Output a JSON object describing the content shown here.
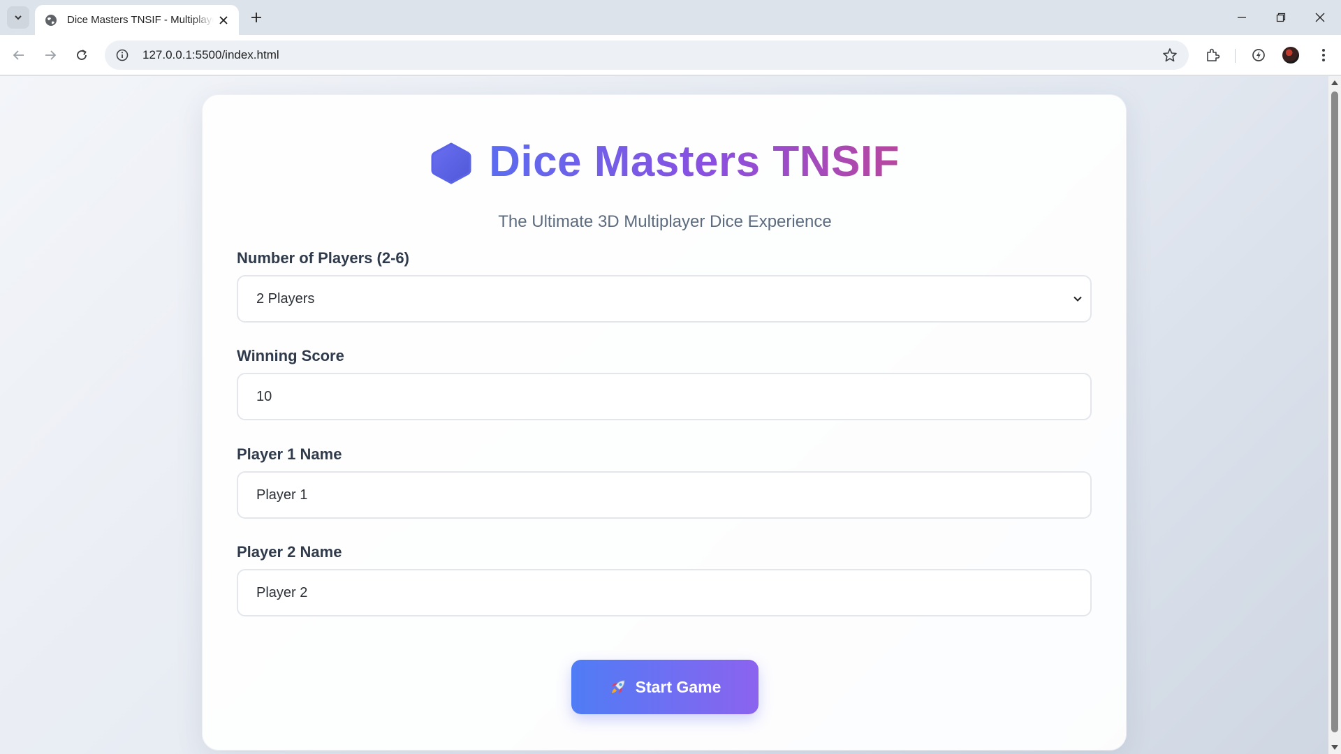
{
  "browser": {
    "tab_title": "Dice Masters TNSIF - Multiplayer",
    "url": "127.0.0.1:5500/index.html"
  },
  "header": {
    "title": "Dice Masters TNSIF",
    "subtitle": "The Ultimate 3D Multiplayer Dice Experience"
  },
  "form": {
    "players_label": "Number of Players (2-6)",
    "players_value": "2 Players",
    "score_label": "Winning Score",
    "score_value": "10",
    "player1_label": "Player 1 Name",
    "player1_value": "Player 1",
    "player2_label": "Player 2 Name",
    "player2_value": "Player 2"
  },
  "actions": {
    "start_label": "Start Game"
  },
  "colors": {
    "accent_start": "#4f7cf5",
    "accent_end": "#8b63ef",
    "title_gradient_end": "#b8479e"
  },
  "icons": [
    "tab-search-icon",
    "globe-icon",
    "close-icon",
    "plus-icon",
    "minimize-icon",
    "restore-icon",
    "back-icon",
    "forward-icon",
    "reload-icon",
    "info-icon",
    "star-icon",
    "extensions-icon",
    "performance-icon",
    "kebab-menu-icon",
    "hexagon-die-icon",
    "rocket-icon",
    "chevron-down-icon"
  ]
}
